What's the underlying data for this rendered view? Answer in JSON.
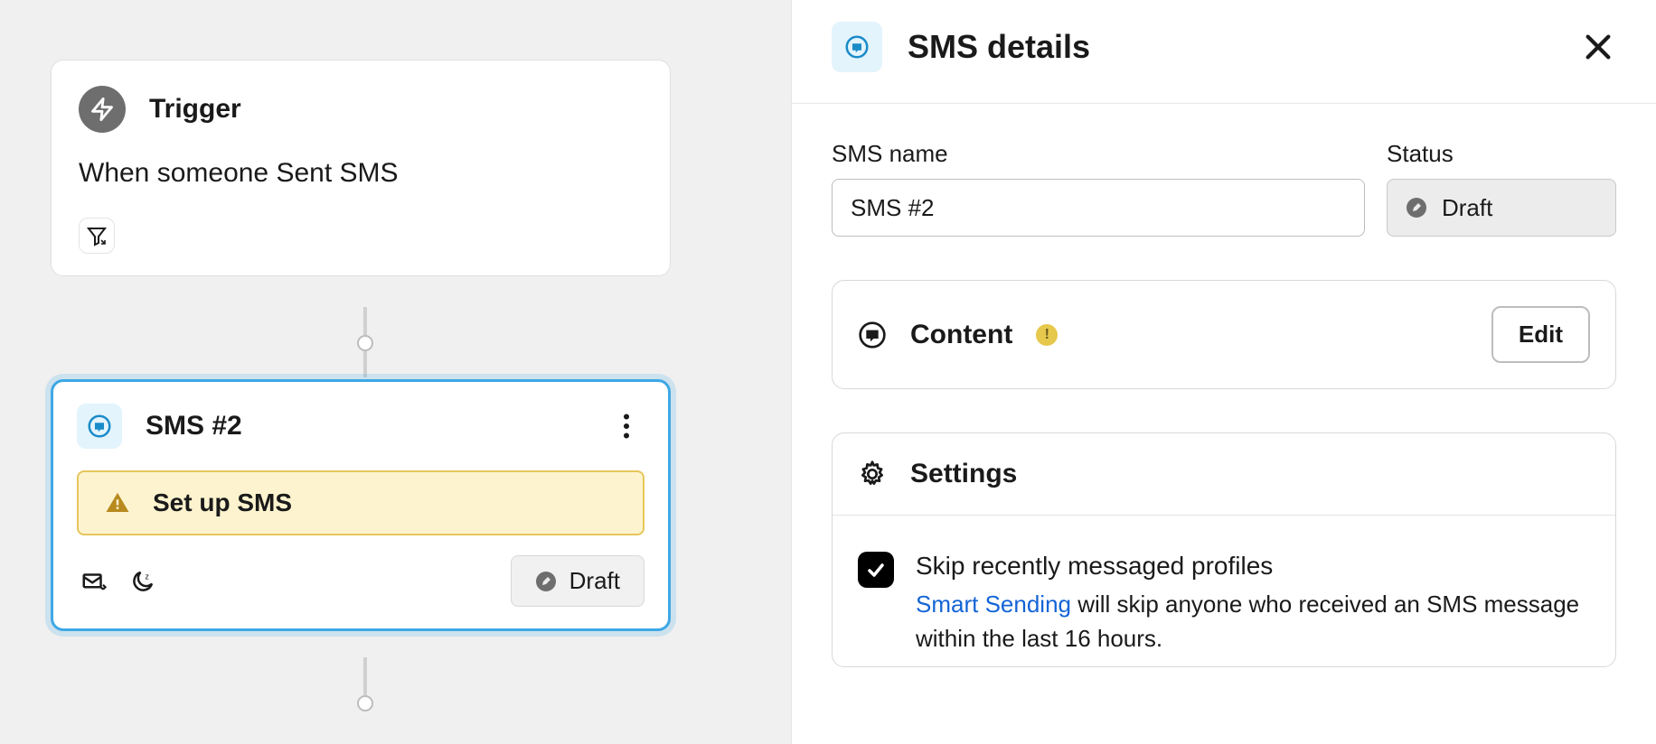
{
  "canvas": {
    "trigger": {
      "title": "Trigger",
      "description": "When someone Sent SMS"
    },
    "sms_card": {
      "title": "SMS #2",
      "warning": "Set up SMS",
      "status": "Draft"
    }
  },
  "panel": {
    "title": "SMS details",
    "name_label": "SMS name",
    "name_value": "SMS #2",
    "status_label": "Status",
    "status_value": "Draft",
    "content_title": "Content",
    "edit_label": "Edit",
    "settings_title": "Settings",
    "skip": {
      "title": "Skip recently messaged profiles",
      "link": "Smart Sending",
      "desc_rest": " will skip anyone who received an SMS message within the last 16 hours."
    }
  }
}
